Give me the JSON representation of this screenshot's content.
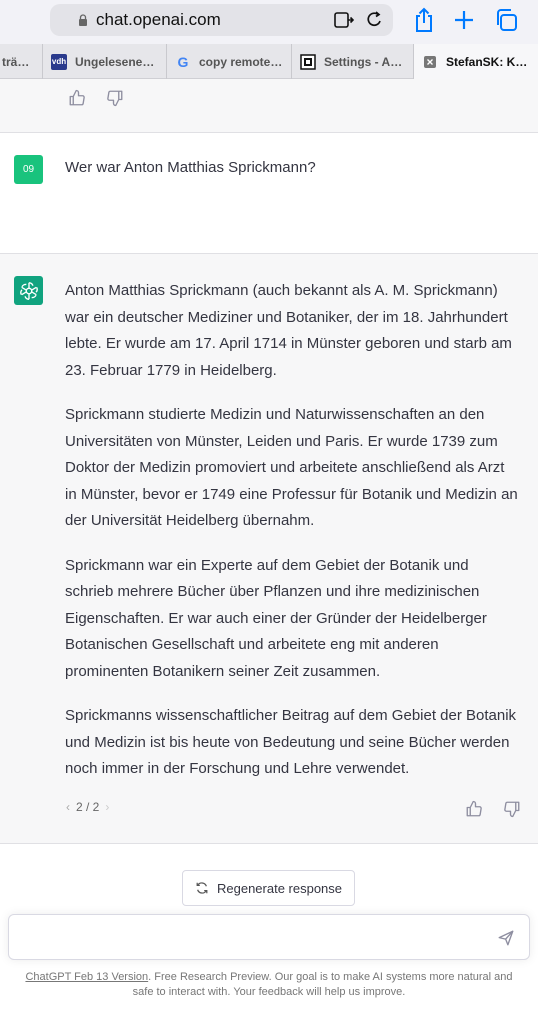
{
  "browser": {
    "url": "chat.openai.com",
    "tabs": [
      {
        "label": "trä…",
        "favicon": "",
        "active": false
      },
      {
        "label": "Ungelesene…",
        "favicon": "vdh",
        "active": false
      },
      {
        "label": "copy remote…",
        "favicon": "G",
        "active": false
      },
      {
        "label": "Settings - A…",
        "favicon": "settings-icon",
        "active": false
      },
      {
        "label": "StefanSK: K…",
        "favicon": "close-icon",
        "active": true
      }
    ]
  },
  "chat": {
    "user": {
      "avatar_text": "09",
      "message": "Wer war Anton Matthias Sprickmann?"
    },
    "assistant": {
      "paragraphs": [
        "Anton Matthias Sprickmann (auch bekannt als A. M. Sprickmann) war ein deutscher Mediziner und Botaniker, der im 18. Jahrhundert lebte. Er wurde am 17. April 1714 in Münster geboren und starb am 23. Februar 1779 in Heidelberg.",
        "Sprickmann studierte Medizin und Naturwissenschaften an den Universitäten von Münster, Leiden und Paris. Er wurde 1739 zum Doktor der Medizin promoviert und arbeitete anschließend als Arzt in Münster, bevor er 1749 eine Professur für Botanik und Medizin an der Universität Heidelberg übernahm.",
        "Sprickmann war ein Experte auf dem Gebiet der Botanik und schrieb mehrere Bücher über Pflanzen und ihre medizinischen Eigenschaften. Er war auch einer der Gründer der Heidelberger Botanischen Gesellschaft und arbeitete eng mit anderen prominenten Botanikern seiner Zeit zusammen.",
        "Sprickmanns wissenschaftlicher Beitrag auf dem Gebiet der Botanik und Medizin ist bis heute von Bedeutung und seine Bücher werden noch immer in der Forschung und Lehre verwendet."
      ],
      "pager": "2 / 2"
    },
    "regenerate_label": "Regenerate response",
    "input_value": "",
    "footer_link": "ChatGPT Feb 13 Version",
    "footer_text": ". Free Research Preview. Our goal is to make AI systems more natural and safe to interact with. Your feedback will help us improve."
  },
  "colors": {
    "accent": "#007aff",
    "user_avatar": "#19c37d",
    "bot_avatar": "#10a37f"
  }
}
